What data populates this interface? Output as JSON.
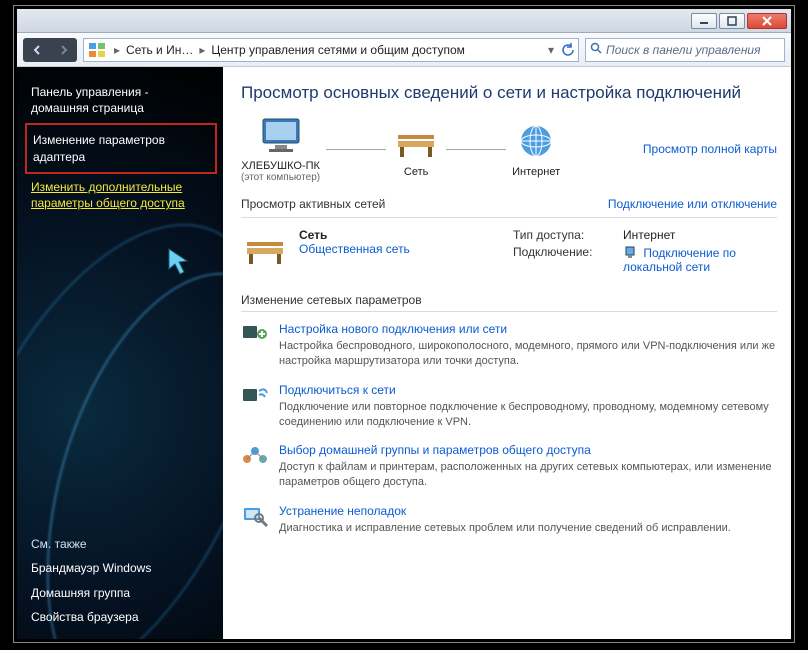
{
  "titlebar": {
    "minimize": "—",
    "maximize": "□",
    "close": "✕"
  },
  "navbar": {
    "back": "◀",
    "fwd": "▶",
    "crumb1": "Сеть и Ин…",
    "crumb2": "Центр управления сетями и общим доступом",
    "search_placeholder": "Поиск в панели управления"
  },
  "sidebar": {
    "cp_home1": "Панель управления -",
    "cp_home2": "домашняя страница",
    "adapter1": "Изменение параметров",
    "adapter2": "адаптера",
    "advshare1": "Изменить дополнительные",
    "advshare2": "параметры общего доступа",
    "seealso": "См. также",
    "firewall": "Брандмауэр Windows",
    "homegroup": "Домашняя группа",
    "browser": "Свойства браузера"
  },
  "main": {
    "heading": "Просмотр основных сведений о сети и настройка подключений",
    "fullmap": "Просмотр полной карты",
    "node_pc": "ХЛЕБУШКО-ПК",
    "node_pc_sub": "(этот компьютер)",
    "node_net": "Сеть",
    "node_inet": "Интернет",
    "active_title": "Просмотр активных сетей",
    "active_connect": "Подключение или отключение",
    "net_name": "Сеть",
    "net_type": "Общественная сеть",
    "prop_type_k": "Тип доступа:",
    "prop_type_v": "Интернет",
    "prop_conn_k": "Подключение:",
    "prop_conn_v": "Подключение по локальной сети",
    "change_title": "Изменение сетевых параметров",
    "t1_t": "Настройка нового подключения или сети",
    "t1_d": "Настройка беспроводного, широкополосного, модемного, прямого или VPN-подключения или же настройка маршрутизатора или точки доступа.",
    "t2_t": "Подключиться к сети",
    "t2_d": "Подключение или повторное подключение к беспроводному, проводному, модемному сетевому соединению или подключение к VPN.",
    "t3_t": "Выбор домашней группы и параметров общего доступа",
    "t3_d": "Доступ к файлам и принтерам, расположенных на других сетевых компьютерах, или изменение параметров общего доступа.",
    "t4_t": "Устранение неполадок",
    "t4_d": "Диагностика и исправление сетевых проблем или получение сведений об исправлении."
  }
}
